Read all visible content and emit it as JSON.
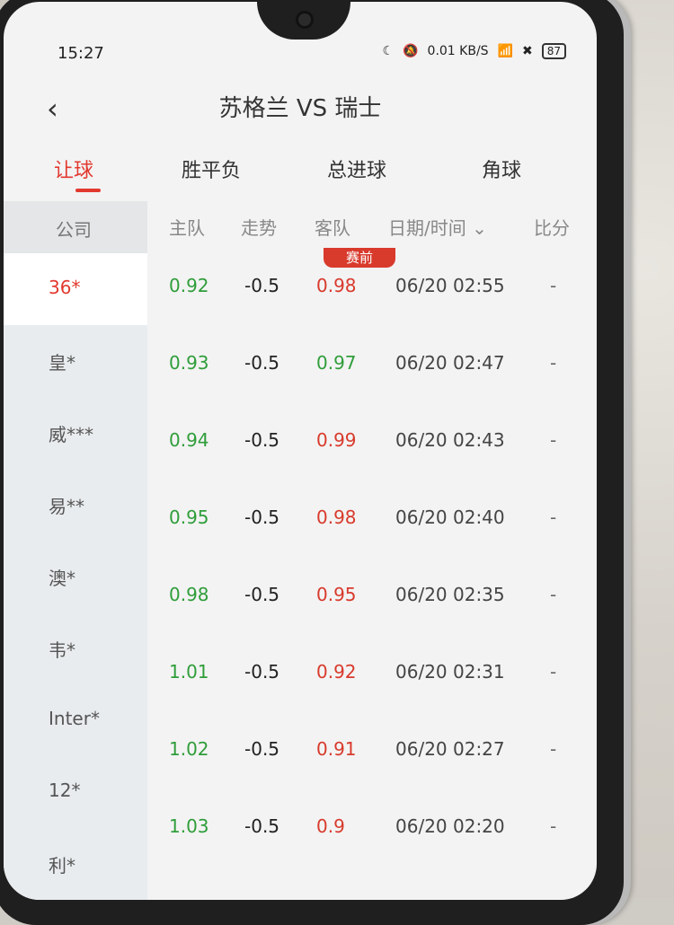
{
  "status": {
    "time": "15:27",
    "net": "0.01 KB/S",
    "battery": "87"
  },
  "titlebar": {
    "title": "苏格兰 VS 瑞士"
  },
  "tabs": [
    "让球",
    "胜平负",
    "总进球",
    "角球"
  ],
  "headers": [
    "公司",
    "主队",
    "走势",
    "客队",
    "日期/时间",
    "比分"
  ],
  "badge": "赛前",
  "companies": [
    "36*",
    "皇*",
    "威***",
    "易**",
    "澳*",
    "韦*",
    "Inter*",
    "12*",
    "利*"
  ],
  "rows": [
    {
      "home": "0.92",
      "trend": "-0.5",
      "away": "0.98",
      "away_color": "red",
      "dt": "06/20 02:55",
      "score": "-"
    },
    {
      "home": "0.93",
      "trend": "-0.5",
      "away": "0.97",
      "away_color": "green",
      "dt": "06/20 02:47",
      "score": "-"
    },
    {
      "home": "0.94",
      "trend": "-0.5",
      "away": "0.99",
      "away_color": "red",
      "dt": "06/20 02:43",
      "score": "-"
    },
    {
      "home": "0.95",
      "trend": "-0.5",
      "away": "0.98",
      "away_color": "red",
      "dt": "06/20 02:40",
      "score": "-"
    },
    {
      "home": "0.98",
      "trend": "-0.5",
      "away": "0.95",
      "away_color": "red",
      "dt": "06/20 02:35",
      "score": "-"
    },
    {
      "home": "1.01",
      "trend": "-0.5",
      "away": "0.92",
      "away_color": "red",
      "dt": "06/20 02:31",
      "score": "-"
    },
    {
      "home": "1.02",
      "trend": "-0.5",
      "away": "0.91",
      "away_color": "red",
      "dt": "06/20 02:27",
      "score": "-"
    },
    {
      "home": "1.03",
      "trend": "-0.5",
      "away": "0.9",
      "away_color": "red",
      "dt": "06/20 02:20",
      "score": "-"
    }
  ]
}
